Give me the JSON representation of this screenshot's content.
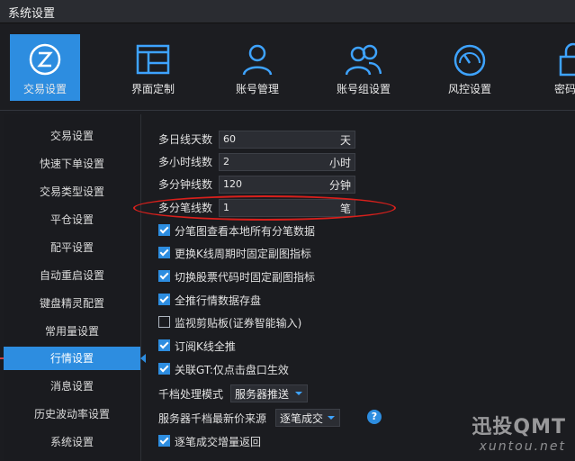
{
  "window": {
    "title": "系统设置"
  },
  "toolbar": {
    "items": [
      {
        "label": "交易设置",
        "icon": "trade-z-icon",
        "active": true
      },
      {
        "label": "界面定制",
        "icon": "layout-icon",
        "active": false
      },
      {
        "label": "账号管理",
        "icon": "user-icon",
        "active": false
      },
      {
        "label": "账号组设置",
        "icon": "user-group-icon",
        "active": false
      },
      {
        "label": "风控设置",
        "icon": "gauge-icon",
        "active": false
      },
      {
        "label": "密码",
        "icon": "lock-icon",
        "active": false
      }
    ]
  },
  "sidebar": {
    "items": [
      {
        "label": "交易设置"
      },
      {
        "label": "快速下单设置"
      },
      {
        "label": "交易类型设置"
      },
      {
        "label": "平仓设置"
      },
      {
        "label": "配平设置"
      },
      {
        "label": "自动重启设置"
      },
      {
        "label": "键盘精灵配置"
      },
      {
        "label": "常用量设置"
      },
      {
        "label": "行情设置",
        "selected": true
      },
      {
        "label": "消息设置"
      },
      {
        "label": "历史波动率设置"
      },
      {
        "label": "系统设置"
      }
    ]
  },
  "settings": {
    "fields": [
      {
        "label": "多日线天数",
        "value": "60",
        "unit": "天"
      },
      {
        "label": "多小时线数",
        "value": "2",
        "unit": "小时"
      },
      {
        "label": "多分钟线数",
        "value": "120",
        "unit": "分钟"
      },
      {
        "label": "多分笔线数",
        "value": "1",
        "unit": "笔"
      }
    ],
    "checkboxes": [
      {
        "label": "分笔图查看本地所有分笔数据",
        "checked": true
      },
      {
        "label": "更换K线周期时固定副图指标",
        "checked": true
      },
      {
        "label": "切换股票代码时固定副图指标",
        "checked": true
      },
      {
        "label": "全推行情数据存盘",
        "checked": true
      },
      {
        "label": "监视剪贴板(证券智能输入)",
        "checked": false
      },
      {
        "label": "订阅K线全推",
        "checked": true
      },
      {
        "label": "关联GT:仅点击盘口生效",
        "checked": true
      }
    ],
    "depth_mode": {
      "label": "千档处理模式",
      "value": "服务器推送"
    },
    "latest_price_source": {
      "label": "服务器千档最新价来源",
      "value": "逐笔成交"
    },
    "tick_incremental": {
      "label": "逐笔成交增量返回",
      "checked": true
    }
  },
  "watermark": {
    "brand": "迅投QMT",
    "site": "xuntou.net"
  },
  "colors": {
    "accent": "#2d8de0",
    "annotation": "#d9201c"
  }
}
